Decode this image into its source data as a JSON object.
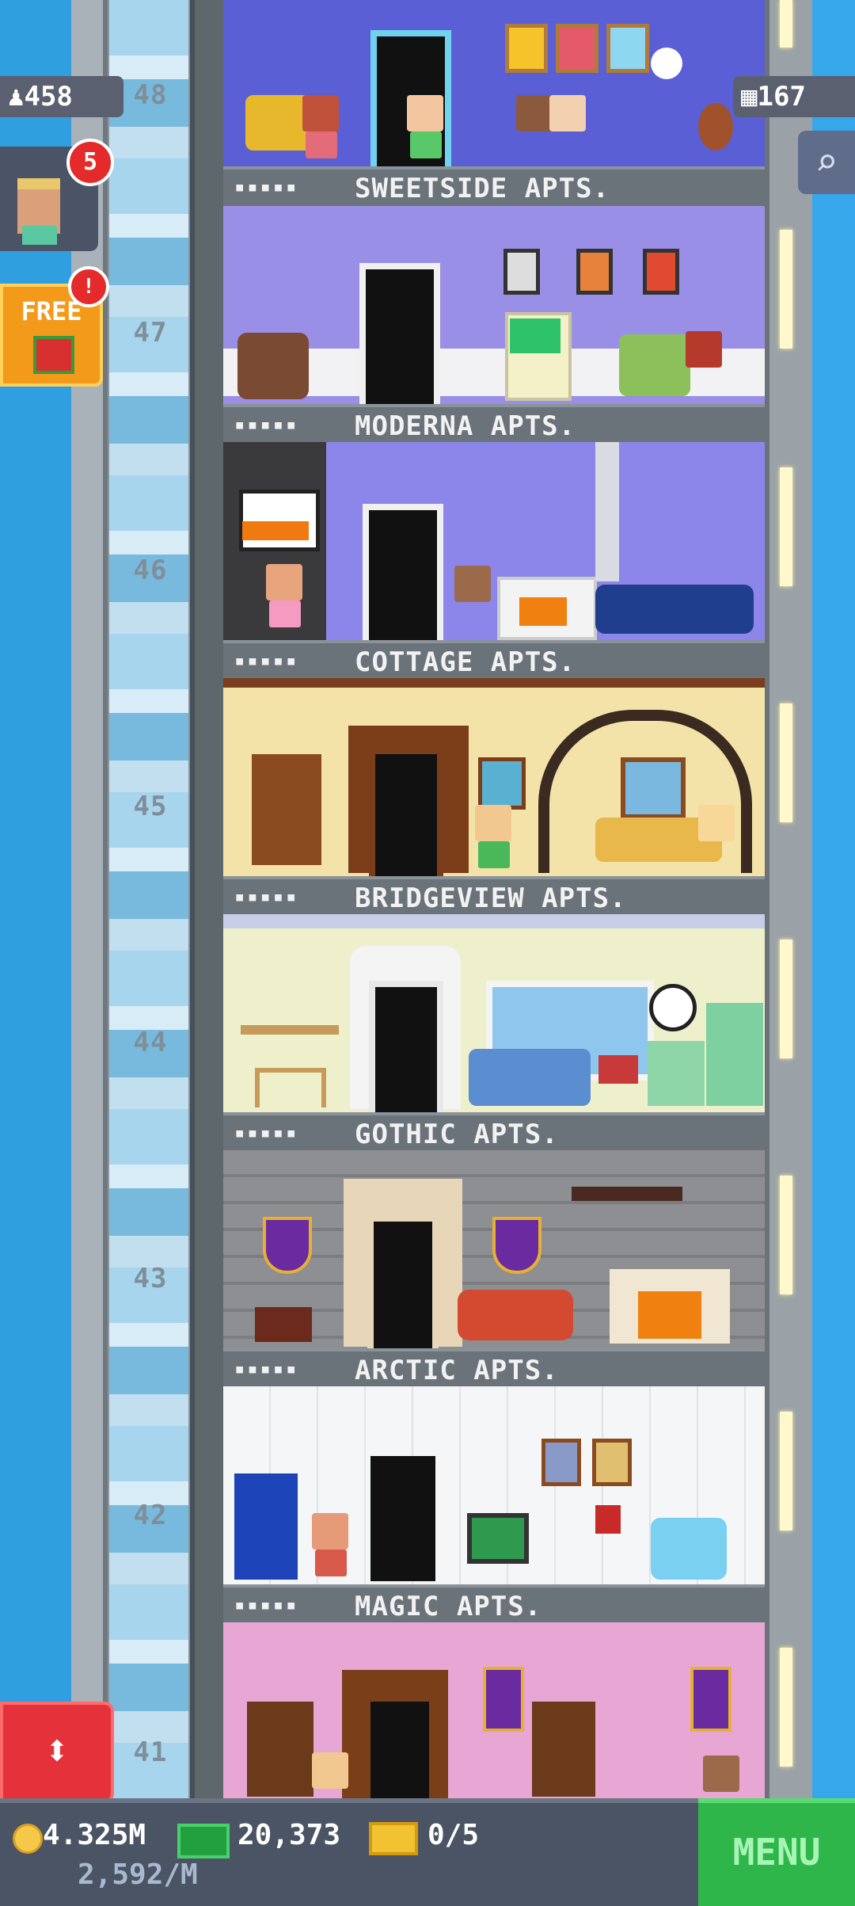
{
  "hud": {
    "population": "458",
    "visitor_badge": "5",
    "free_label": "FREE",
    "free_badge": "!",
    "floors_count": "167",
    "coins": "4.325M",
    "income": "2,592/M",
    "bux": "20,373",
    "tickets": "0/5",
    "menu_label": "MENU"
  },
  "floors": [
    {
      "number": "48",
      "name": "SWEETSIDE APTS.",
      "residents": "▪▪▪▪▪",
      "wall": "#6a6ee0"
    },
    {
      "number": "47",
      "name": "MODERNA APTS.",
      "residents": "▪▪▪▪▪",
      "wall": "#9a8fe6"
    },
    {
      "number": "46",
      "name": "COTTAGE APTS.",
      "residents": "▪▪▪▪▪",
      "wall": "#8c86ea"
    },
    {
      "number": "45",
      "name": "BRIDGEVIEW APTS.",
      "residents": "▪▪▪▪▪",
      "wall": "#f3e3a8"
    },
    {
      "number": "44",
      "name": "GOTHIC APTS.",
      "residents": "▪▪▪▪▪",
      "wall": "#eef0cc"
    },
    {
      "number": "43",
      "name": "ARCTIC APTS.",
      "residents": "▪▪▪▪▪",
      "wall": "#8d8f92"
    },
    {
      "number": "42",
      "name": "MAGIC APTS.",
      "residents": "▪▪▪▪▪",
      "wall": "#f4f6f7"
    },
    {
      "number": "41",
      "name": "",
      "residents": "",
      "wall": "#e8a6d4"
    }
  ],
  "icons": {
    "population": "person-icon",
    "floors": "building-icon",
    "search": "magnifier-icon",
    "elevator": "up-down-arrows-icon",
    "gift": "gift-icon"
  }
}
